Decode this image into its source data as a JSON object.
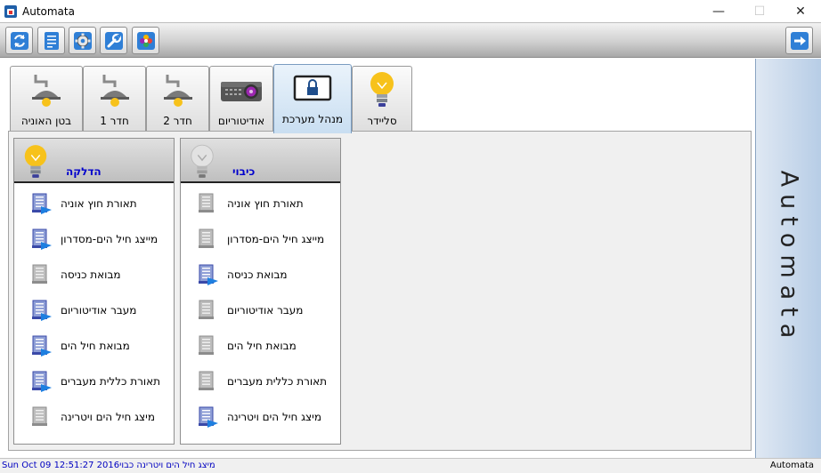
{
  "window": {
    "title": "Automata",
    "minimize_glyph": "—",
    "maximize_glyph": "☐",
    "close_glyph": "✕"
  },
  "toolbar": {
    "buttons": [
      {
        "name": "refresh-icon"
      },
      {
        "name": "document-icon"
      },
      {
        "name": "gear-icon"
      },
      {
        "name": "wrench-icon"
      },
      {
        "name": "photos-icon"
      },
      {
        "name": "exit-arrow-icon"
      }
    ]
  },
  "tabs": [
    {
      "label": "בטן האוניה",
      "icon": "ceiling-lamp-icon"
    },
    {
      "label": "חדר 1",
      "icon": "ceiling-lamp-icon"
    },
    {
      "label": "חדר 2",
      "icon": "ceiling-lamp-icon"
    },
    {
      "label": "אודיטוריום",
      "icon": "projector-icon"
    },
    {
      "label": "מנהל מערכת",
      "icon": "lock-screen-icon",
      "active": true
    },
    {
      "label": "סליידר",
      "icon": "lightbulb-icon"
    }
  ],
  "groups": {
    "on": {
      "title": "הדלקה",
      "icon": "lightbulb-on-icon",
      "items": [
        {
          "label": "תאורת חוץ אוניה",
          "state": "active"
        },
        {
          "label": "מייצג חיל הים-מסדרון",
          "state": "active"
        },
        {
          "label": "מבואת כניסה",
          "state": "inactive"
        },
        {
          "label": "מעבר אודיטוריום",
          "state": "active"
        },
        {
          "label": "מבואת חיל הים",
          "state": "active"
        },
        {
          "label": "תאורת כללית מעברים",
          "state": "active"
        },
        {
          "label": "מיצג חיל הים ויטרינה",
          "state": "inactive"
        }
      ]
    },
    "off": {
      "title": "כיבוי",
      "icon": "lightbulb-off-icon",
      "items": [
        {
          "label": "תאורת חוץ אוניה",
          "state": "inactive"
        },
        {
          "label": "מייצג חיל הים-מסדרון",
          "state": "inactive"
        },
        {
          "label": "מבואת כניסה",
          "state": "active"
        },
        {
          "label": "מעבר אודיטוריום",
          "state": "inactive"
        },
        {
          "label": "מבואת חיל הים",
          "state": "inactive"
        },
        {
          "label": "תאורת כללית מעברים",
          "state": "inactive"
        },
        {
          "label": "מיצג חיל הים ויטרינה",
          "state": "active"
        }
      ]
    }
  },
  "side_brand": "Automata",
  "status": {
    "left": "Sun Oct 09 12:51:27 2016מיצג חיל הים ויטרינה כבוי",
    "right": "Automata"
  },
  "colors": {
    "accent_blue": "#0000cc",
    "active_tab": "#c9def1",
    "bulb_yellow": "#f7c21b",
    "doc_arrow_blue": "#1e7fe0"
  }
}
